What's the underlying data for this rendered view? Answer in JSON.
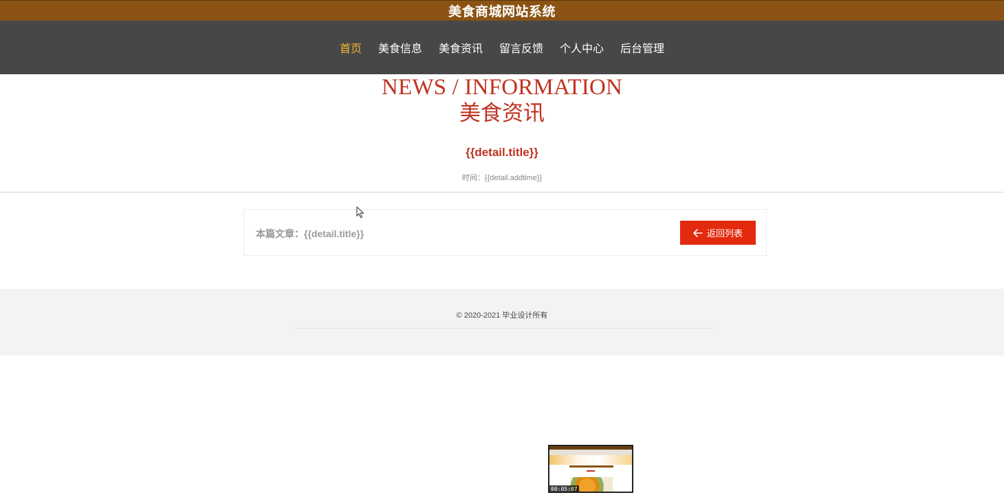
{
  "header": {
    "site_title": "美食商城网站系统"
  },
  "nav": {
    "items": [
      {
        "label": "首页",
        "active": true
      },
      {
        "label": "美食信息",
        "active": false
      },
      {
        "label": "美食资讯",
        "active": false
      },
      {
        "label": "留言反馈",
        "active": false
      },
      {
        "label": "个人中心",
        "active": false
      },
      {
        "label": "后台管理",
        "active": false
      }
    ]
  },
  "section": {
    "en_title": "NEWS / INFORMATION",
    "zh_title": "美食资讯"
  },
  "article": {
    "title": "{{detail.title}}",
    "time": "时间：{{detail.addtime}}",
    "current_label": "本篇文章：{{detail.title}}",
    "back_button": "返回列表"
  },
  "footer": {
    "copyright": "© 2020-2021 毕业设计所有"
  },
  "thumbnail": {
    "timestamp": "00:05:07"
  },
  "colors": {
    "topbar": "#8a5313",
    "navbar": "#474747",
    "nav_active": "#f4b72e",
    "accent_red": "#c0321f",
    "button_red": "#e3290e",
    "footer_bg": "#f3f3f3"
  }
}
